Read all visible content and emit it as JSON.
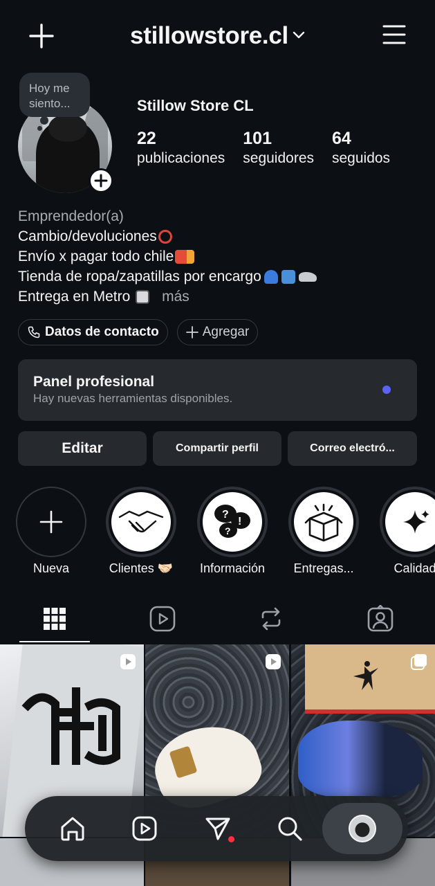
{
  "header": {
    "username": "stillowstore.cl",
    "icons": [
      "plus-icon",
      "chevron-down-icon",
      "menu-icon"
    ]
  },
  "profile": {
    "note": "Hoy me siento...",
    "name": "Stillow Store CL",
    "stats": [
      {
        "count": "22",
        "label": "publicaciones"
      },
      {
        "count": "101",
        "label": "seguidores"
      },
      {
        "count": "64",
        "label": "seguidos"
      }
    ]
  },
  "bio": {
    "category": "Emprendedor(a)",
    "lines": [
      "Cambio/devoluciones",
      "Envío x pagar todo chile",
      "Tienda de ropa/zapatillas por encargo",
      "Entrega en Metro"
    ],
    "more": "más"
  },
  "chips": {
    "contact": "Datos de contacto",
    "add": "Agregar"
  },
  "panel": {
    "title": "Panel profesional",
    "subtitle": "Hay nuevas herramientas disponibles.",
    "dot_color": "#5b63f6"
  },
  "buttons": {
    "edit": "Editar",
    "share": "Compartir perfil",
    "email": "Correo electró..."
  },
  "highlights": [
    {
      "label": "Nueva",
      "icon": "plus-icon"
    },
    {
      "label": "Clientes 🤝🏻",
      "icon": "handshake-icon"
    },
    {
      "label": "Información",
      "icon": "question-bubbles-icon"
    },
    {
      "label": "Entregas...",
      "icon": "box-icon"
    },
    {
      "label": "Calidad",
      "icon": "sparkle-icon"
    }
  ],
  "tabs": [
    "grid-icon",
    "reels-icon",
    "reposts-icon",
    "tagged-icon"
  ],
  "posts": [
    {
      "type": "reel",
      "desc": "grey tee with black gothic letter"
    },
    {
      "type": "reel",
      "desc": "white sneakers on paisley bandana"
    },
    {
      "type": "carousel",
      "desc": "jordan box with blue sneakers"
    }
  ],
  "bottom_nav": [
    "home-icon",
    "reels-icon",
    "direct-icon",
    "search-icon",
    "profile-avatar"
  ],
  "colors": {
    "background": "#0c1014",
    "surface": "#26292e",
    "accent": "#5b63f6",
    "notification": "#ff3040"
  }
}
